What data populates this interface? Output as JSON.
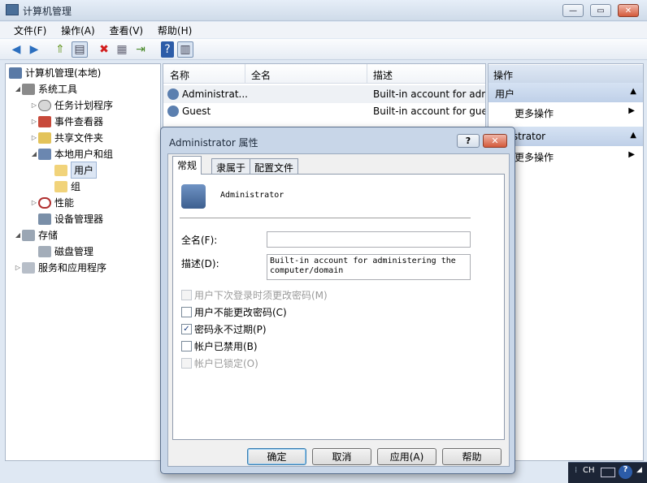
{
  "window": {
    "title": "计算机管理",
    "min": "—",
    "max": "▭",
    "close": "✕"
  },
  "menu": [
    "文件(F)",
    "操作(A)",
    "查看(V)",
    "帮助(H)"
  ],
  "tree": [
    {
      "label": "计算机管理(本地)",
      "exp": ""
    },
    {
      "label": "系统工具",
      "exp": "◢"
    },
    {
      "label": "任务计划程序",
      "exp": "▷"
    },
    {
      "label": "事件查看器",
      "exp": "▷"
    },
    {
      "label": "共享文件夹",
      "exp": "▷"
    },
    {
      "label": "本地用户和组",
      "exp": "◢"
    },
    {
      "label": "用户",
      "exp": ""
    },
    {
      "label": "组",
      "exp": ""
    },
    {
      "label": "性能",
      "exp": "▷"
    },
    {
      "label": "设备管理器",
      "exp": ""
    },
    {
      "label": "存储",
      "exp": "◢"
    },
    {
      "label": "磁盘管理",
      "exp": ""
    },
    {
      "label": "服务和应用程序",
      "exp": "▷"
    }
  ],
  "list": {
    "columns": [
      "名称",
      "全名",
      "描述"
    ],
    "rows": [
      {
        "name": "Administrat...",
        "fullname": "",
        "desc": "Built-in account for adm"
      },
      {
        "name": "Guest",
        "fullname": "",
        "desc": "Built-in account for gues"
      }
    ]
  },
  "actions": {
    "header": "操作",
    "section1": "用户",
    "item1": "更多操作",
    "section2": "ninistrator",
    "item2": "更多操作"
  },
  "dialog": {
    "title": "Administrator 属性",
    "help": "?",
    "close": "✕",
    "tabs": [
      "常规",
      "隶属于",
      "配置文件"
    ],
    "username": "Administrator",
    "fullname_label": "全名(F):",
    "fullname_value": "",
    "desc_label": "描述(D):",
    "desc_value": "Built-in account for administering the computer/domain",
    "checkboxes": [
      {
        "label": "用户下次登录时须更改密码(M)",
        "checked": false,
        "disabled": true
      },
      {
        "label": "用户不能更改密码(C)",
        "checked": false,
        "disabled": false
      },
      {
        "label": "密码永不过期(P)",
        "checked": true,
        "disabled": false
      },
      {
        "label": "帐户已禁用(B)",
        "checked": false,
        "disabled": false
      },
      {
        "label": "帐户已锁定(O)",
        "checked": false,
        "disabled": true
      }
    ],
    "buttons": {
      "ok": "确定",
      "cancel": "取消",
      "apply": "应用(A)",
      "help": "帮助"
    }
  },
  "taskbar": {
    "lang": "CH",
    "help": "?"
  }
}
